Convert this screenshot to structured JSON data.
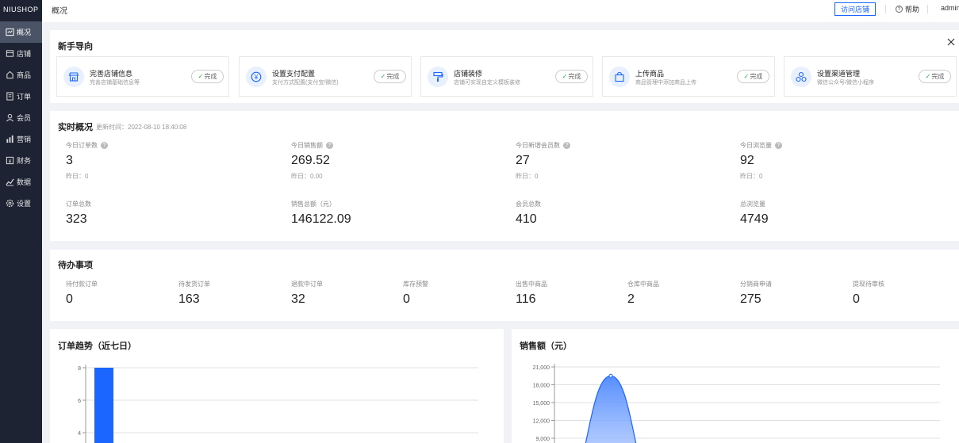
{
  "app": {
    "logo": "NIUSHOP"
  },
  "sidebar": {
    "items": [
      {
        "label": "概况",
        "icon": "overview-icon",
        "active": true
      },
      {
        "label": "店铺",
        "icon": "store-icon"
      },
      {
        "label": "商品",
        "icon": "goods-icon"
      },
      {
        "label": "订单",
        "icon": "order-icon"
      },
      {
        "label": "会员",
        "icon": "member-icon"
      },
      {
        "label": "营销",
        "icon": "marketing-icon"
      },
      {
        "label": "财务",
        "icon": "finance-icon"
      },
      {
        "label": "数据",
        "icon": "data-icon"
      },
      {
        "label": "设置",
        "icon": "settings-icon"
      }
    ]
  },
  "header": {
    "title": "概况",
    "visit_store": "访问店铺",
    "help": "帮助",
    "user": "admin"
  },
  "guide": {
    "title": "新手导向",
    "items": [
      {
        "name": "完善店铺信息",
        "desc": "完善店铺基础信息等",
        "status": "完成",
        "icon": "store-front-icon"
      },
      {
        "name": "设置支付配置",
        "desc": "支付方式配置(支付宝/微信)",
        "status": "完成",
        "icon": "yen-icon"
      },
      {
        "name": "店铺装修",
        "desc": "店铺可实现自定义模板装修",
        "status": "完成",
        "icon": "paint-roller-icon"
      },
      {
        "name": "上传商品",
        "desc": "商品管理中添加商品上传",
        "status": "完成",
        "icon": "shopping-bag-icon"
      },
      {
        "name": "设置渠道管理",
        "desc": "微信公众号/微信小程序",
        "status": "完成",
        "icon": "channel-icon"
      }
    ]
  },
  "realtime": {
    "title": "实时概况",
    "update_time": "更新时间：2022-08-10 18:40:08",
    "today": [
      {
        "label": "今日订单数",
        "value": "3",
        "yesterday": "昨日：0"
      },
      {
        "label": "今日销售额",
        "value": "269.52",
        "yesterday": "昨日：0.00"
      },
      {
        "label": "今日新增会员数",
        "value": "27",
        "yesterday": "昨日：0"
      },
      {
        "label": "今日浏览量",
        "value": "92",
        "yesterday": "昨日：0"
      }
    ],
    "totals": [
      {
        "label": "订单总数",
        "value": "323"
      },
      {
        "label": "销售总额（元）",
        "value": "146122.09"
      },
      {
        "label": "会员总数",
        "value": "410"
      },
      {
        "label": "总浏览量",
        "value": "4749"
      }
    ]
  },
  "todo": {
    "title": "待办事项",
    "items": [
      {
        "label": "待付款订单",
        "value": "0"
      },
      {
        "label": "待发货订单",
        "value": "163"
      },
      {
        "label": "退款中订单",
        "value": "32"
      },
      {
        "label": "库存预警",
        "value": "0"
      },
      {
        "label": "出售中商品",
        "value": "116"
      },
      {
        "label": "仓库中商品",
        "value": "2"
      },
      {
        "label": "分销商申请",
        "value": "275"
      },
      {
        "label": "提现待审核",
        "value": "0"
      }
    ]
  },
  "chart_data": [
    {
      "type": "bar",
      "title": "订单趋势（近七日）",
      "y_ticks": [
        "8",
        "6",
        "4"
      ],
      "ylim": [
        0,
        8
      ],
      "values": [
        8
      ],
      "color": "#1a66ff",
      "grid": true
    },
    {
      "type": "area",
      "title": "销售额（元）",
      "y_ticks": [
        "21,000",
        "18,000",
        "15,000",
        "12,000",
        "9,000"
      ],
      "ylim": [
        0,
        21000
      ],
      "peak": 19500,
      "color": "#1a66ff",
      "grid": true
    }
  ],
  "colors": {
    "accent": "#1a66ff",
    "sidebar_bg": "#1d2333",
    "sidebar_active": "#4a5466",
    "success": "#27a745"
  }
}
